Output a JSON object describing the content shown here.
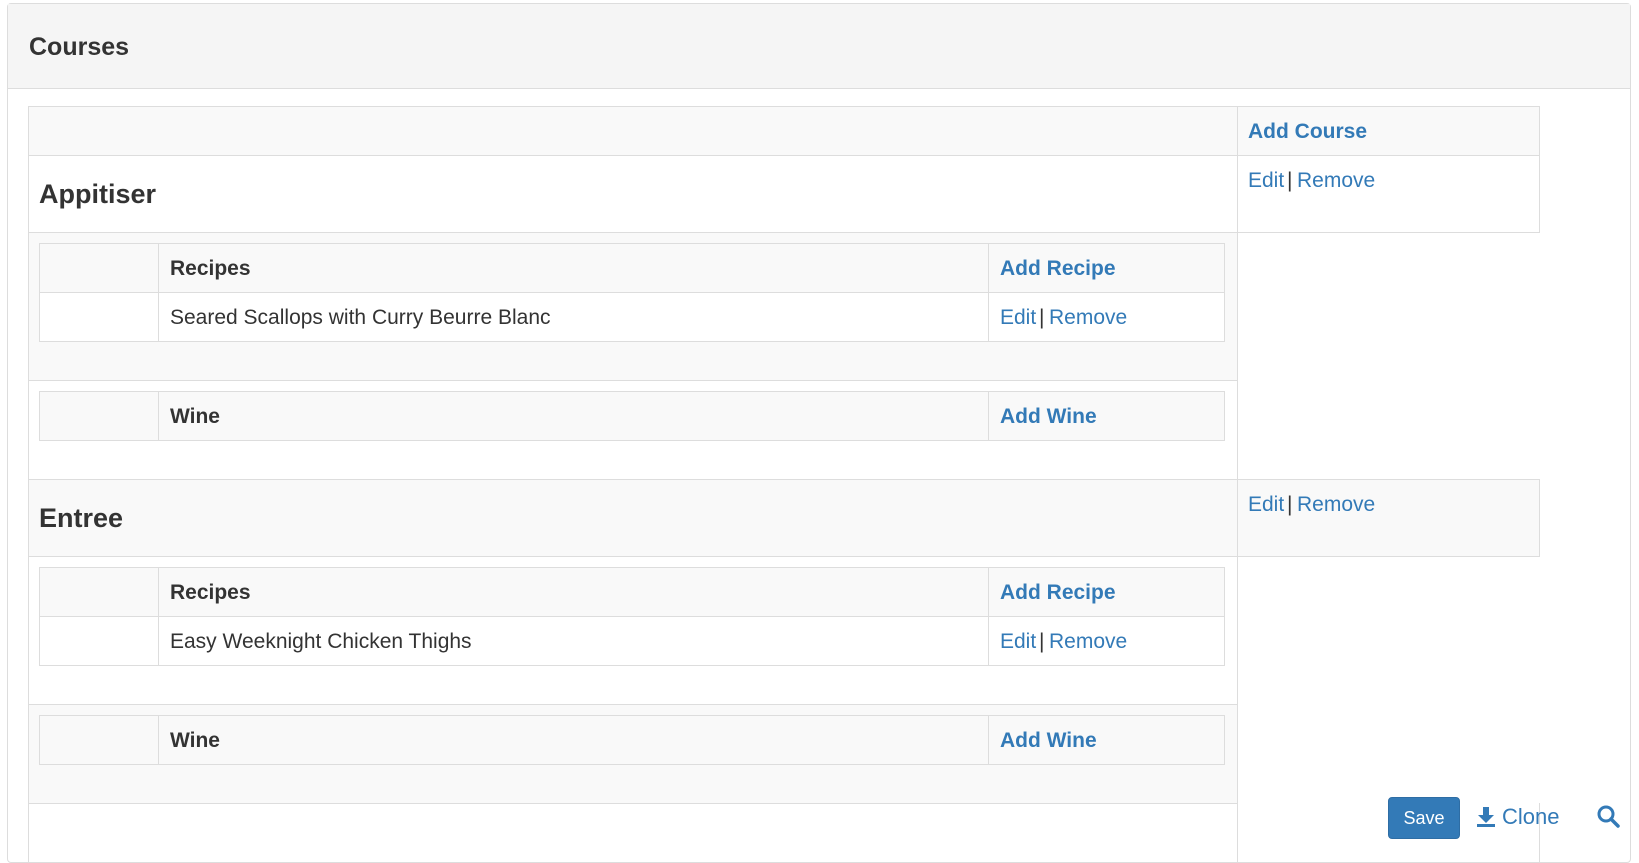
{
  "panel": {
    "title": "Courses"
  },
  "courses_table": {
    "add_course_label": "Add Course",
    "edit_label": "Edit",
    "separator": "|",
    "remove_label": "Remove",
    "courses": [
      {
        "name": "Appitiser",
        "recipes_header": "Recipes",
        "add_recipe_label": "Add Recipe",
        "recipes": [
          {
            "name": "Seared Scallops with Curry Beurre Blanc"
          }
        ],
        "wine_header": "Wine",
        "add_wine_label": "Add Wine"
      },
      {
        "name": "Entree",
        "recipes_header": "Recipes",
        "add_recipe_label": "Add Recipe",
        "recipes": [
          {
            "name": "Easy Weeknight Chicken Thighs"
          }
        ],
        "wine_header": "Wine",
        "add_wine_label": "Add Wine"
      }
    ]
  },
  "footer_actions": {
    "save_label": "Save",
    "clone_label": "Clone",
    "icons": [
      "download-icon",
      "search-icon"
    ],
    "accent_color": "#337ab7"
  }
}
